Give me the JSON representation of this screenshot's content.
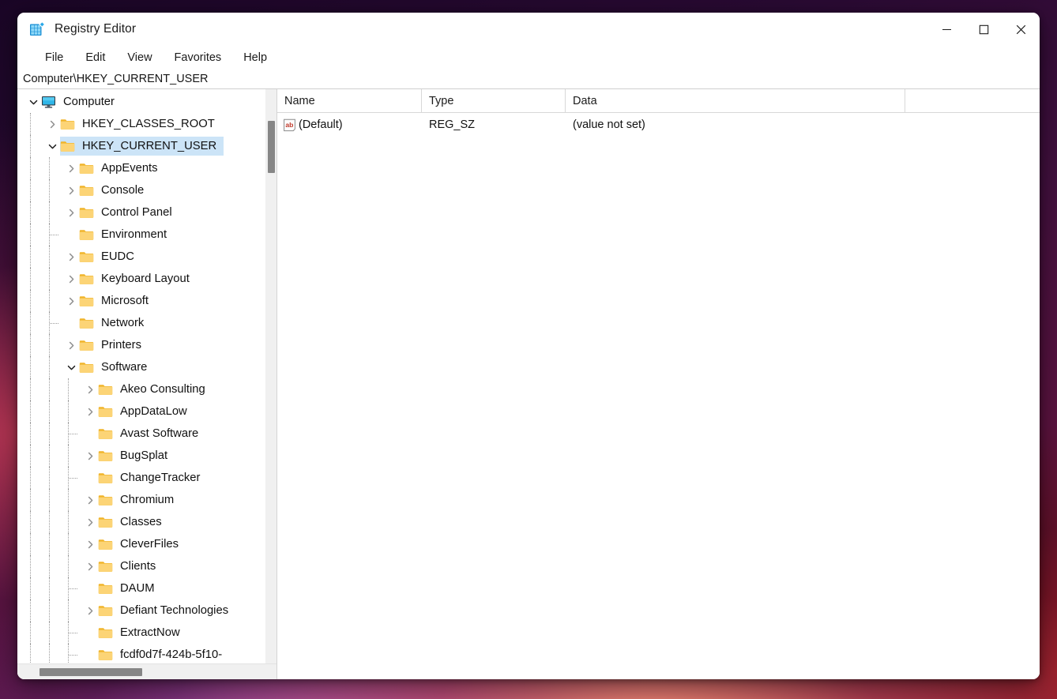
{
  "window": {
    "title": "Registry Editor",
    "icon": "registry-editor-icon",
    "controls": {
      "minimize": "minimize-icon",
      "maximize": "maximize-icon",
      "close": "close-icon"
    }
  },
  "menubar": {
    "items": [
      {
        "label": "File"
      },
      {
        "label": "Edit"
      },
      {
        "label": "View"
      },
      {
        "label": "Favorites"
      },
      {
        "label": "Help"
      }
    ]
  },
  "addressbar": {
    "path": "Computer\\HKEY_CURRENT_USER"
  },
  "tree": {
    "nodes": [
      {
        "label": "Computer",
        "depth": 0,
        "icon": "monitor-icon",
        "state": "expanded",
        "selected": false
      },
      {
        "label": "HKEY_CLASSES_ROOT",
        "depth": 1,
        "icon": "folder-icon",
        "state": "collapsed",
        "selected": false
      },
      {
        "label": "HKEY_CURRENT_USER",
        "depth": 1,
        "icon": "folder-icon",
        "state": "expanded",
        "selected": true
      },
      {
        "label": "AppEvents",
        "depth": 2,
        "icon": "folder-icon",
        "state": "collapsed",
        "selected": false
      },
      {
        "label": "Console",
        "depth": 2,
        "icon": "folder-icon",
        "state": "collapsed",
        "selected": false
      },
      {
        "label": "Control Panel",
        "depth": 2,
        "icon": "folder-icon",
        "state": "collapsed",
        "selected": false
      },
      {
        "label": "Environment",
        "depth": 2,
        "icon": "folder-icon",
        "state": "leaf",
        "selected": false
      },
      {
        "label": "EUDC",
        "depth": 2,
        "icon": "folder-icon",
        "state": "collapsed",
        "selected": false
      },
      {
        "label": "Keyboard Layout",
        "depth": 2,
        "icon": "folder-icon",
        "state": "collapsed",
        "selected": false
      },
      {
        "label": "Microsoft",
        "depth": 2,
        "icon": "folder-icon",
        "state": "collapsed",
        "selected": false
      },
      {
        "label": "Network",
        "depth": 2,
        "icon": "folder-icon",
        "state": "leaf",
        "selected": false
      },
      {
        "label": "Printers",
        "depth": 2,
        "icon": "folder-icon",
        "state": "collapsed",
        "selected": false
      },
      {
        "label": "Software",
        "depth": 2,
        "icon": "folder-icon",
        "state": "expanded",
        "selected": false
      },
      {
        "label": "Akeo Consulting",
        "depth": 3,
        "icon": "folder-icon",
        "state": "collapsed",
        "selected": false
      },
      {
        "label": "AppDataLow",
        "depth": 3,
        "icon": "folder-icon",
        "state": "collapsed",
        "selected": false
      },
      {
        "label": "Avast Software",
        "depth": 3,
        "icon": "folder-icon",
        "state": "leaf",
        "selected": false
      },
      {
        "label": "BugSplat",
        "depth": 3,
        "icon": "folder-icon",
        "state": "collapsed",
        "selected": false
      },
      {
        "label": "ChangeTracker",
        "depth": 3,
        "icon": "folder-icon",
        "state": "leaf",
        "selected": false
      },
      {
        "label": "Chromium",
        "depth": 3,
        "icon": "folder-icon",
        "state": "collapsed",
        "selected": false
      },
      {
        "label": "Classes",
        "depth": 3,
        "icon": "folder-icon",
        "state": "collapsed",
        "selected": false
      },
      {
        "label": "CleverFiles",
        "depth": 3,
        "icon": "folder-icon",
        "state": "collapsed",
        "selected": false
      },
      {
        "label": "Clients",
        "depth": 3,
        "icon": "folder-icon",
        "state": "collapsed",
        "selected": false
      },
      {
        "label": "DAUM",
        "depth": 3,
        "icon": "folder-icon",
        "state": "leaf",
        "selected": false
      },
      {
        "label": "Defiant Technologies",
        "depth": 3,
        "icon": "folder-icon",
        "state": "collapsed",
        "selected": false
      },
      {
        "label": "ExtractNow",
        "depth": 3,
        "icon": "folder-icon",
        "state": "leaf",
        "selected": false
      },
      {
        "label": "fcdf0d7f-424b-5f10-",
        "depth": 3,
        "icon": "folder-icon",
        "state": "leaf",
        "selected": false
      }
    ]
  },
  "list": {
    "columns": [
      {
        "label": "Name"
      },
      {
        "label": "Type"
      },
      {
        "label": "Data"
      }
    ],
    "rows": [
      {
        "icon": "string-value-icon",
        "name": "(Default)",
        "type": "REG_SZ",
        "data": "(value not set)"
      }
    ]
  },
  "colors": {
    "selection": "#cce4f7",
    "folder": "#ffd264",
    "accent": "#0078d4",
    "scrollbar_thumb": "#868686"
  }
}
